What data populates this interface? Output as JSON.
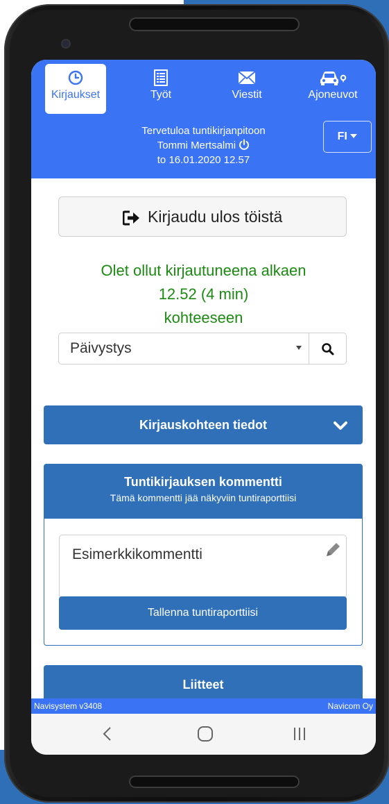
{
  "colors": {
    "header_blue": "#3b73f5",
    "panel_blue": "#2f70b8",
    "status_green": "#1c8a12"
  },
  "nav": {
    "items": [
      {
        "label": "Kirjaukset",
        "icon": "clock-icon",
        "active": true
      },
      {
        "label": "Työt",
        "icon": "list-icon",
        "active": false
      },
      {
        "label": "Viestit",
        "icon": "envelope-icon",
        "active": false
      },
      {
        "label": "Ajoneuvot",
        "icon": "car-icon",
        "active": false
      }
    ]
  },
  "header": {
    "welcome": "Tervetuloa tuntikirjanpitoon",
    "user": "Tommi Mertsalmi",
    "datetime": "to 16.01.2020 12.57",
    "lang": "FI"
  },
  "logout": {
    "label": "Kirjaudu ulos töistä",
    "icon": "sign-out-icon"
  },
  "status": {
    "line1": "Olet ollut kirjautuneena alkaen",
    "line2": "12.52 (4 min)",
    "line3": "kohteeseen"
  },
  "target": {
    "selected": "Päivystys"
  },
  "info_panel": {
    "label": "Kirjauskohteen tiedot"
  },
  "comment": {
    "title": "Tuntikirjauksen kommentti",
    "subtitle": "Tämä kommentti jää näkyviin tuntiraporttiisi",
    "value": "Esimerkkikommentti",
    "save_label": "Tallenna tuntiraporttiisi"
  },
  "attachments": {
    "label": "Liitteet"
  },
  "footer": {
    "left": "Navisystem v3408",
    "right": "Navicom Oy"
  }
}
